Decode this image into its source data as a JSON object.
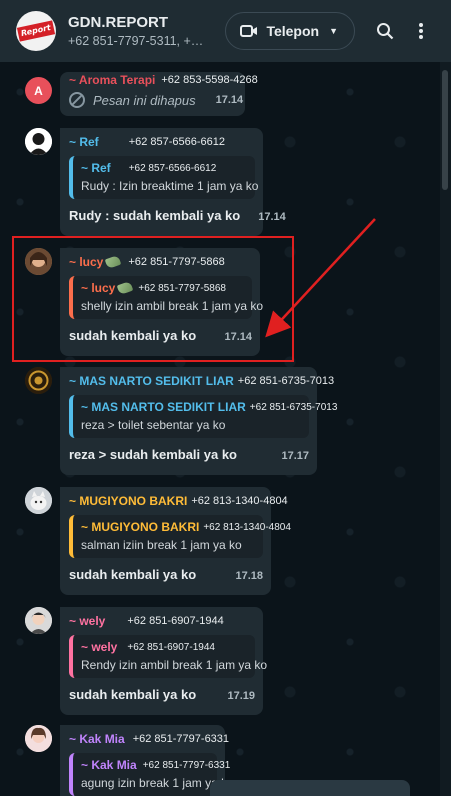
{
  "header": {
    "title": "GDN.REPORT",
    "subtitle": "+62 851-7797-5311, +6…",
    "avatar_text": "Report",
    "call_label": "Telepon"
  },
  "icons": {
    "video": "video-camera-icon",
    "caret": "chevron-down-icon",
    "search": "search-icon",
    "menu": "more-vertical-icon"
  },
  "messages": [
    {
      "id": "aroma",
      "avatar_letter": "A",
      "avatar_color": "#e8505b",
      "sender": "~ Aroma Terapi",
      "sender_color": "#e8505b",
      "phone": "+62 853-5598-4268",
      "deleted_text": "Pesan ini dihapus",
      "time": "17.14"
    },
    {
      "id": "ref",
      "sender": "~ Ref",
      "sender_color": "#53bdeb",
      "phone": "+62 857-6566-6612",
      "quote_sender": "~ Ref",
      "quote_phone": "+62 857-6566-6612",
      "quote_color": "#53bdeb",
      "quote_text": "Rudy : Izin breaktime 1 jam ya ko",
      "body": "Rudy : sudah kembali ya ko",
      "time": "17.14"
    },
    {
      "id": "lucy",
      "sender": "~ lucy",
      "sender_color": "#fc6e4c",
      "phone": "+62 851-7797-5868",
      "quote_sender": "~ lucy",
      "quote_phone": "+62 851-7797-5868",
      "quote_color": "#fc6e4c",
      "quote_text": "shelly izin ambil break 1 jam ya ko",
      "body": "sudah kembali ya ko",
      "time": "17.14"
    },
    {
      "id": "narto",
      "sender": "~ MAS NARTO SEDIKIT LIAR",
      "sender_color": "#53bdeb",
      "phone": "+62 851-6735-7013",
      "quote_sender": "~ MAS NARTO SEDIKIT LIAR",
      "quote_phone": "+62 851-6735-7013",
      "quote_color": "#53bdeb",
      "quote_text": "reza > toilet sebentar ya ko",
      "body": "reza > sudah kembali ya ko",
      "time": "17.17"
    },
    {
      "id": "mugiyono",
      "sender": "~ MUGIYONO BAKRI",
      "sender_color": "#ffbc38",
      "phone": "+62 813-1340-4804",
      "quote_sender": "~ MUGIYONO BAKRI",
      "quote_phone": "+62 813-1340-4804",
      "quote_color": "#ffbc38",
      "quote_text": "salman iziin break 1 jam ya ko",
      "body": "sudah kembali ya ko",
      "time": "17.18"
    },
    {
      "id": "wely",
      "sender": "~ wely",
      "sender_color": "#ff72a1",
      "phone": "+62 851-6907-1944",
      "quote_sender": "~ wely",
      "quote_phone": "+62 851-6907-1944",
      "quote_color": "#ff72a1",
      "quote_text": "Rendy izin ambil break 1 jam ya ko",
      "body": "sudah kembali ya ko",
      "time": "17.19"
    },
    {
      "id": "kakmia",
      "sender": "~ Kak Mia",
      "sender_color": "#c084fc",
      "phone": "+62 851-7797-6331",
      "quote_sender": "~ Kak Mia",
      "quote_phone": "+62 851-7797-6331",
      "quote_color": "#c084fc",
      "quote_text": "agung izin break 1 jam ya ko",
      "body": "",
      "time": ""
    }
  ]
}
